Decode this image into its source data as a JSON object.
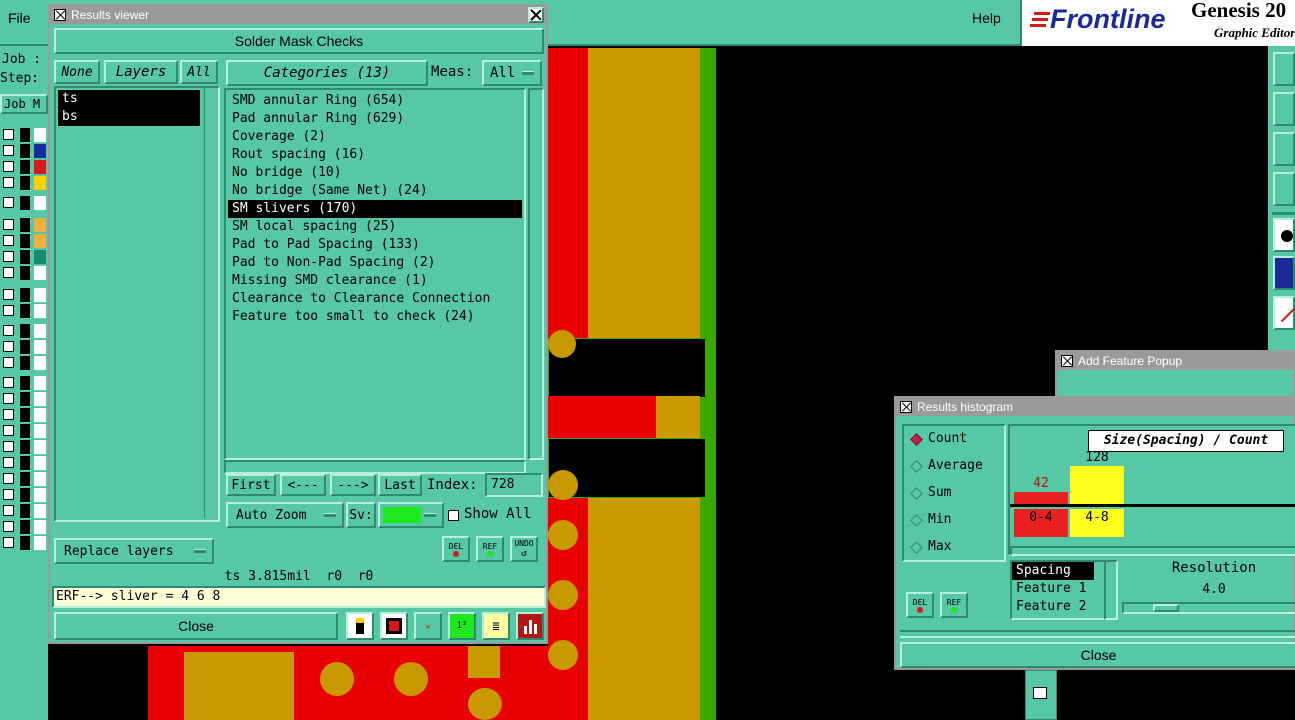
{
  "menubar": {
    "file": "File",
    "help": "Help"
  },
  "brand": {
    "logo": "Frontline",
    "product": "Genesis 20",
    "subtitle": "Graphic Editor"
  },
  "left_panel": {
    "job": "Job :",
    "step": "Step:",
    "job_menu": "Job M"
  },
  "results_viewer": {
    "window_title": "Results viewer",
    "heading": "Solder Mask Checks",
    "none_btn": "None",
    "layers_btn": "Layers",
    "all_btn": "All",
    "layers": [
      "ts",
      "bs"
    ],
    "categories_btn": "Categories (13)",
    "meas_label": "Meas:",
    "meas_value": "All",
    "categories": [
      "SMD annular Ring (654)",
      "Pad annular Ring (629)",
      "Coverage (2)",
      "Rout spacing (16)",
      "No bridge (10)",
      "No bridge (Same Net) (24)",
      "SM slivers (170)",
      "SM local spacing (25)",
      "Pad to Pad Spacing (133)",
      "Pad to Non-Pad Spacing (2)",
      "Missing SMD clearance (1)",
      "Clearance to Clearance Connection",
      "Feature too small to check (24)"
    ],
    "selected_category": "SM slivers (170)",
    "first_btn": "First",
    "prev_btn": "<---",
    "next_btn": "--->",
    "last_btn": "Last",
    "index_label": "Index:",
    "index_value": "728",
    "auto_zoom": "Auto Zoom",
    "sv_label": "Sv:",
    "show_all": "Show All",
    "replace_layers": "Replace layers",
    "del_label": "DEL",
    "ref_label": "REF",
    "undo_label": "UNDO",
    "status": "ts 3.815mil  r0  r0",
    "erf": "ERF--> sliver = 4 6 8",
    "close": "Close"
  },
  "add_feature": {
    "window_title": "Add Feature Popup"
  },
  "histogram": {
    "window_title": "Results histogram",
    "modes": [
      "Count",
      "Average",
      "Sum",
      "Min",
      "Max"
    ],
    "selected_mode": "Count",
    "chart_title": "Size(Spacing) / Count",
    "bars": [
      {
        "label": "0-4",
        "count": 42,
        "color": "#e82020"
      },
      {
        "label": "4-8",
        "count": 128,
        "color": "#ffff20"
      }
    ],
    "fields": [
      "Spacing",
      "Feature 1",
      "Feature 2"
    ],
    "selected_field": "Spacing",
    "resolution_label": "Resolution",
    "resolution_value": "4.0",
    "resolution_fraction": 0.2,
    "del_label": "DEL",
    "ref_label": "REF",
    "close": "Close"
  }
}
